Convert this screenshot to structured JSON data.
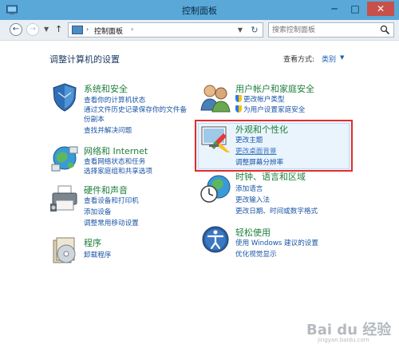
{
  "window": {
    "title": "控制面板",
    "min": "─",
    "max": "□",
    "close": "✕"
  },
  "nav": {
    "back": "←",
    "forward": "→",
    "up": "↑",
    "breadcrumb": "控制面板",
    "sep": "›",
    "refresh": "↻"
  },
  "search": {
    "placeholder": "搜索控制面板"
  },
  "main": {
    "heading": "调整计算机的设置",
    "view_by_label": "查看方式:",
    "view_by_value": "类别"
  },
  "categories": [
    {
      "title": "系统和安全",
      "icon": "shield-icon",
      "links": [
        "查看你的计算机状态",
        "通过文件历史记录保存你的文件备",
        "份副本",
        "查找并解决问题"
      ]
    },
    {
      "title": "网络和 Internet",
      "icon": "network-icon",
      "links": [
        "查看网络状态和任务",
        "选择家庭组和共享选项"
      ]
    },
    {
      "title": "硬件和声音",
      "icon": "printer-icon",
      "links": [
        "查看设备和打印机",
        "添加设备",
        "调整常用移动设置"
      ]
    },
    {
      "title": "程序",
      "icon": "programs-icon",
      "links": [
        "卸载程序"
      ]
    },
    {
      "title": "用户帐户和家庭安全",
      "icon": "users-icon",
      "links": [
        "更改帐户类型",
        "为用户设置家庭安全"
      ]
    },
    {
      "title": "外观和个性化",
      "icon": "appearance-icon",
      "links": [
        "更改主题",
        "更改桌面背景",
        "调整屏幕分辨率"
      ]
    },
    {
      "title": "时钟、语言和区域",
      "icon": "clock-globe-icon",
      "links": [
        "添加语言",
        "更改输入法",
        "更改日期、时间或数字格式"
      ]
    },
    {
      "title": "轻松使用",
      "icon": "ease-of-access-icon",
      "links": [
        "使用 Windows 建议的设置",
        "优化视觉显示"
      ]
    }
  ],
  "watermark": {
    "text": "Bai du 经验",
    "sub": "jingyan.baidu.com"
  },
  "colors": {
    "titlebar": "#59a8d8",
    "category_title": "#1e7e3c",
    "link": "#1a55a6",
    "highlight_border": "#e42b2b"
  }
}
